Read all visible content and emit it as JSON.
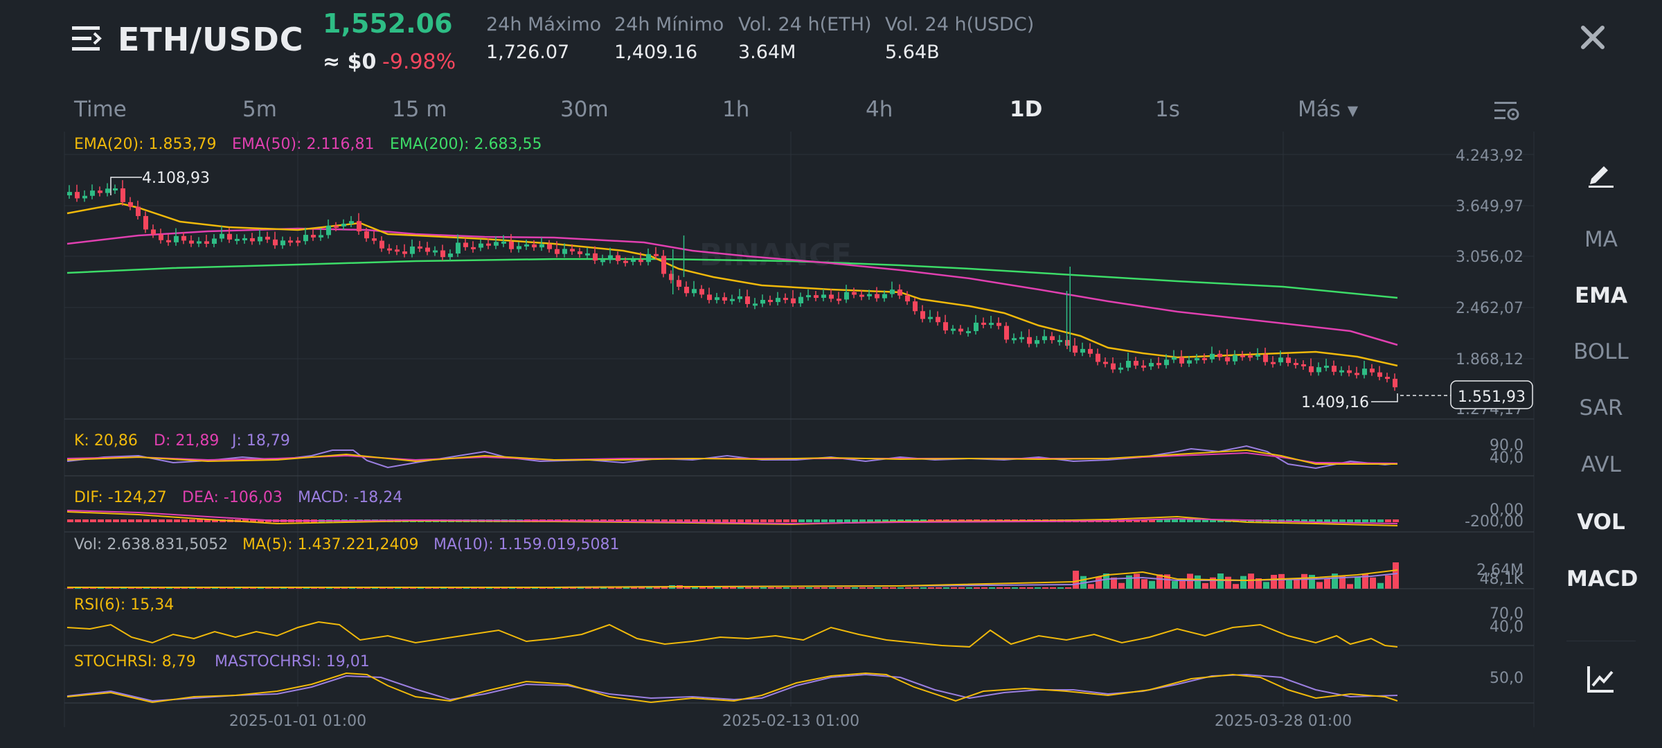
{
  "header": {
    "pair": "ETH/USDC",
    "price": "1,552.06",
    "usd_value": "≈ $0",
    "change": "-9.98%",
    "stats": [
      {
        "label": "24h Máximo",
        "value": "1,726.07"
      },
      {
        "label": "24h Mínimo",
        "value": "1,409.16"
      },
      {
        "label": "Vol. 24 h(ETH)",
        "value": "3.64M"
      },
      {
        "label": "Vol. 24 h(USDC)",
        "value": "5.64B"
      }
    ]
  },
  "timeframes": [
    "Time",
    "5m",
    "15 m",
    "30m",
    "1h",
    "4h",
    "1D",
    "1s",
    "Más"
  ],
  "active_timeframe": "1D",
  "side_panel": [
    "MA",
    "EMA",
    "BOLL",
    "SAR",
    "AVL",
    "VOL",
    "MACD"
  ],
  "indicators": {
    "ema20": "EMA(20): 1.853,79",
    "ema50": "EMA(50): 2.116,81",
    "ema200": "EMA(200): 2.683,55",
    "kdj_k": "K: 20,86",
    "kdj_d": "D: 21,89",
    "kdj_j": "J: 18,79",
    "dif": "DIF: -124,27",
    "dea": "DEA: -106,03",
    "macd": "MACD: -18,24",
    "vol": "Vol: 2.638.831,5052",
    "vol_ma5": "MA(5): 1.437.221,2409",
    "vol_ma10": "MA(10): 1.159.019,5081",
    "rsi": "RSI(6): 15,34",
    "stochrsi": "STOCHRSI: 8,79",
    "mastochrsi": "MASTOCHRSI: 19,01"
  },
  "price_axis": [
    "4.243,92",
    "3.649,97",
    "3.056,02",
    "2.462,07",
    "1.868,12",
    "1.274,17"
  ],
  "current_price_label": "1.551,93",
  "high_marker": "4.108,93",
  "low_marker": "1.409,16",
  "kdj_axis": [
    "90,0",
    "40,0"
  ],
  "macd_axis": [
    "0,00",
    "-200,00"
  ],
  "vol_axis": [
    "2,64M",
    "48,1K"
  ],
  "rsi_axis": [
    "70,0",
    "40,0"
  ],
  "stoch_axis": [
    "50,0"
  ],
  "date_labels": [
    "2025-01-01 01:00",
    "2025-02-13 01:00",
    "2025-03-28 01:00"
  ],
  "watermark": "BINANCE",
  "colors": {
    "background": "#1e2329",
    "up": "#2ebd85",
    "down": "#f6465d",
    "ema20": "#f0b90b",
    "ema50": "#e040b0",
    "ema200": "#3ddc68",
    "kdj_j": "#9b7fe0",
    "text_muted": "#848e9c"
  },
  "icons": [
    "menu-icon",
    "close-icon",
    "chart-settings-icon",
    "draw-tool-icon",
    "chart-type-icon"
  ]
}
